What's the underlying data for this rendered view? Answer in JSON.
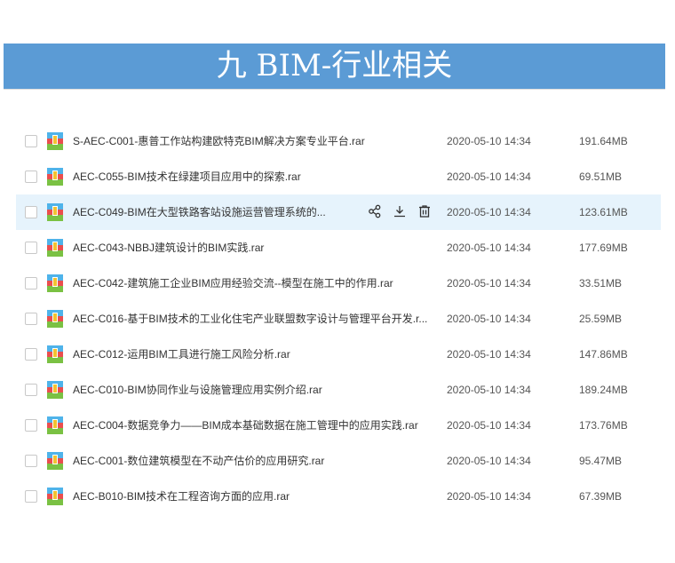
{
  "banner": {
    "title": "九 BIM-行业相关"
  },
  "row_actions": {
    "share": "share-icon",
    "download": "download-icon",
    "delete": "trash-icon"
  },
  "files": [
    {
      "name": "S-AEC-C001-惠普工作站构建欧特克BIM解决方案专业平台.rar",
      "date": "2020-05-10 14:34",
      "size": "191.64MB"
    },
    {
      "name": "AEC-C055-BIM技术在绿建项目应用中的探索.rar",
      "date": "2020-05-10 14:34",
      "size": "69.51MB"
    },
    {
      "name": "AEC-C049-BIM在大型铁路客站设施运营管理系统的...",
      "date": "2020-05-10 14:34",
      "size": "123.61MB"
    },
    {
      "name": "AEC-C043-NBBJ建筑设计的BIM实践.rar",
      "date": "2020-05-10 14:34",
      "size": "177.69MB"
    },
    {
      "name": "AEC-C042-建筑施工企业BIM应用经验交流--模型在施工中的作用.rar",
      "date": "2020-05-10 14:34",
      "size": "33.51MB"
    },
    {
      "name": "AEC-C016-基于BIM技术的工业化住宅产业联盟数字设计与管理平台开发.r...",
      "date": "2020-05-10 14:34",
      "size": "25.59MB"
    },
    {
      "name": "AEC-C012-运用BIM工具进行施工风险分析.rar",
      "date": "2020-05-10 14:34",
      "size": "147.86MB"
    },
    {
      "name": "AEC-C010-BIM协同作业与设施管理应用实例介绍.rar",
      "date": "2020-05-10 14:34",
      "size": "189.24MB"
    },
    {
      "name": "AEC-C004-数据竞争力——BIM成本基础数据在施工管理中的应用实践.rar",
      "date": "2020-05-10 14:34",
      "size": "173.76MB"
    },
    {
      "name": "AEC-C001-数位建筑模型在不动产估价的应用研究.rar",
      "date": "2020-05-10 14:34",
      "size": "95.47MB"
    },
    {
      "name": "AEC-B010-BIM技术在工程咨询方面的应用.rar",
      "date": "2020-05-10 14:34",
      "size": "67.39MB"
    }
  ]
}
